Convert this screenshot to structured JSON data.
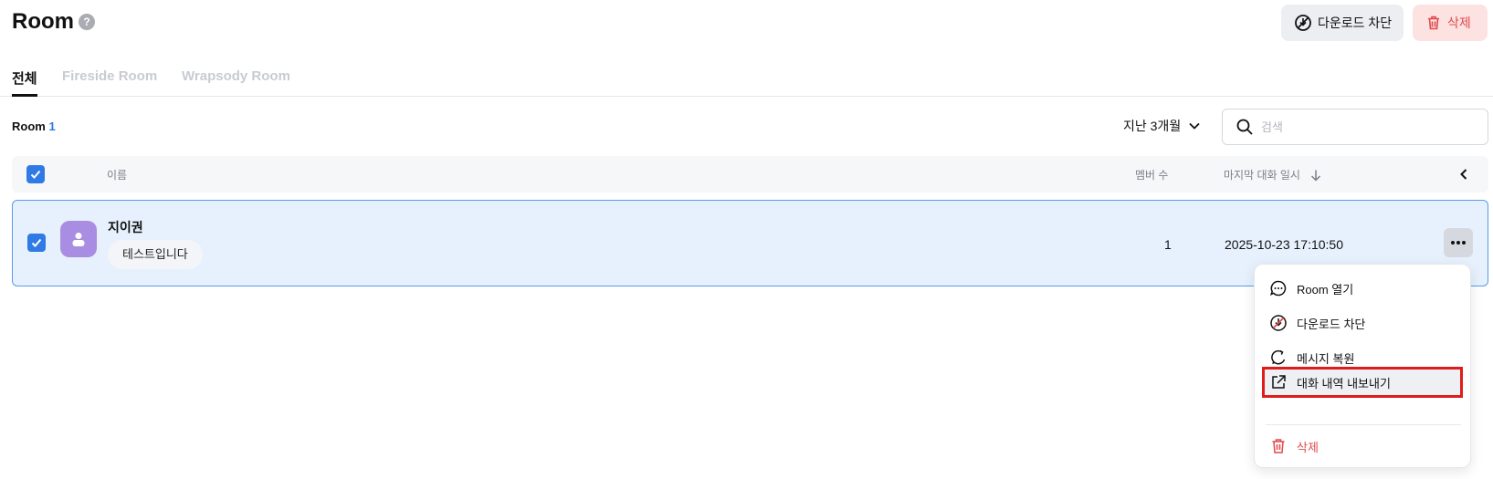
{
  "header": {
    "title": "Room",
    "help_glyph": "?",
    "block_download_label": "다운로드 차단",
    "delete_label": "삭제"
  },
  "tabs": [
    {
      "label": "전체",
      "active": true
    },
    {
      "label": "Fireside Room",
      "active": false
    },
    {
      "label": "Wrapsody Room",
      "active": false
    }
  ],
  "list": {
    "count_label": "Room",
    "count_value": "1",
    "period_filter": "지난 3개월",
    "search_placeholder": "검색"
  },
  "table": {
    "columns": {
      "name": "이름",
      "members": "멤버 수",
      "last_chat": "마지막 대화 일시"
    },
    "rows": [
      {
        "name": "지이권",
        "last_message": "테스트입니다",
        "members": "1",
        "last_chat_at": "2025-10-23 17:10:50",
        "selected": true
      }
    ]
  },
  "context_menu": {
    "items": [
      {
        "label": "Room 열기",
        "icon": "chat-bubble-icon"
      },
      {
        "label": "다운로드 차단",
        "icon": "download-block-icon"
      },
      {
        "label": "메시지 복원",
        "icon": "restore-icon"
      },
      {
        "label": "대화 내역 내보내기",
        "icon": "export-icon",
        "highlighted": true
      },
      {
        "label": "삭제",
        "icon": "trash-icon",
        "danger": true
      }
    ]
  },
  "colors": {
    "accent": "#2f7ae5",
    "danger": "#e04a4a",
    "row_selected_bg": "#e7f1fd",
    "highlight_border": "#e01b1b",
    "avatar_bg": "#a98de2"
  }
}
